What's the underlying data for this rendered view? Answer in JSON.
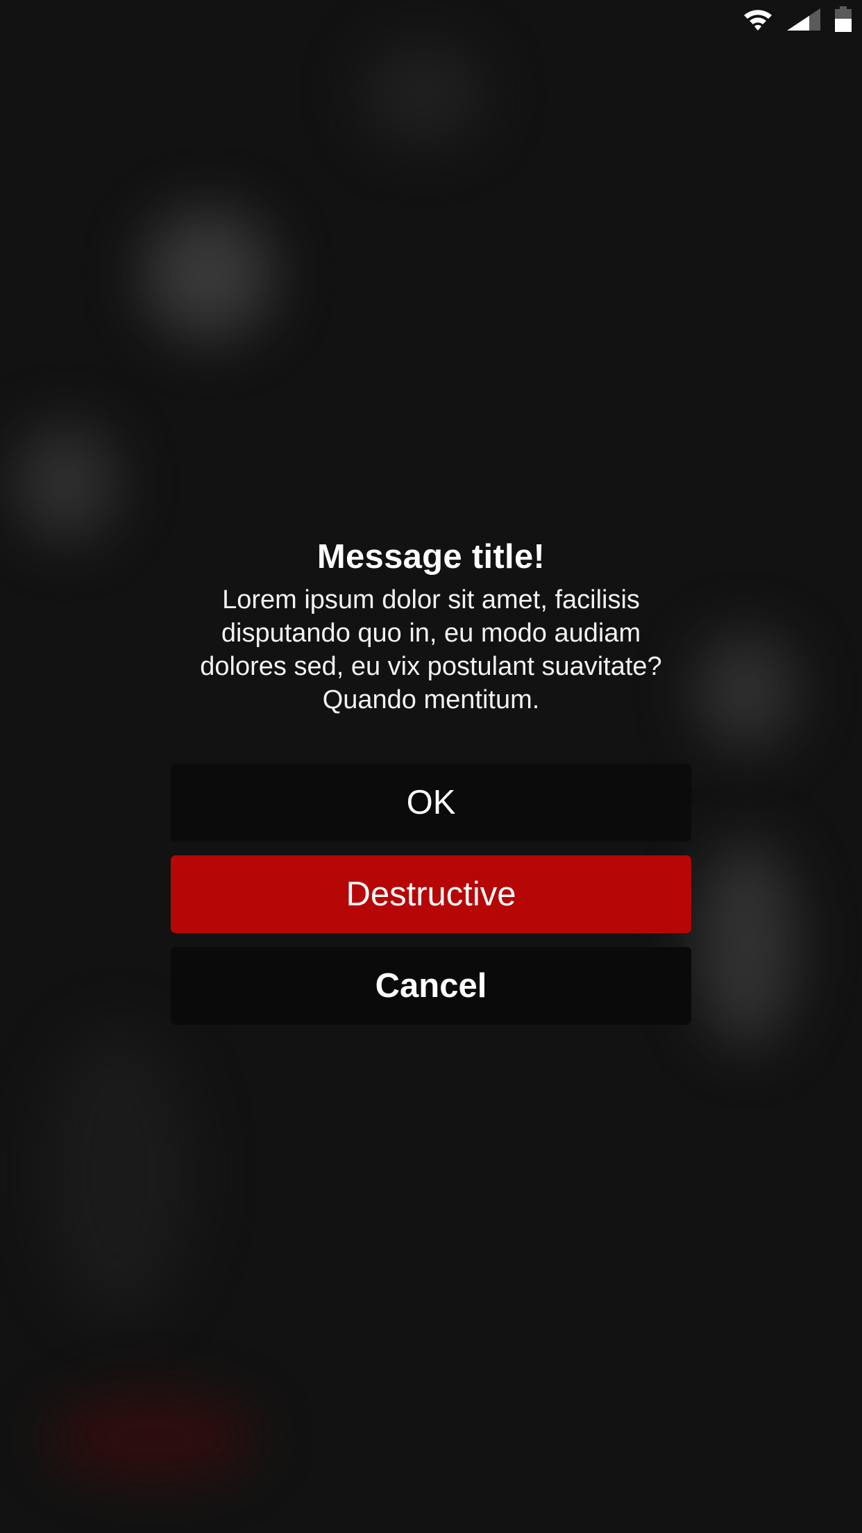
{
  "status_bar": {
    "icons": [
      "wifi-icon",
      "cellular-signal-icon",
      "battery-icon"
    ]
  },
  "dialog": {
    "title": "Message title!",
    "message": "Lorem ipsum dolor sit amet, facilisis disputando quo in, eu modo audiam dolores sed, eu vix postulant suavitate? Quando mentitum.",
    "buttons": {
      "ok": "OK",
      "destructive": "Destructive",
      "cancel": "Cancel"
    }
  },
  "colors": {
    "background": "#121212",
    "destructive": "#b70606",
    "button_dark": "#0b0b0b",
    "text": "#ffffff"
  }
}
